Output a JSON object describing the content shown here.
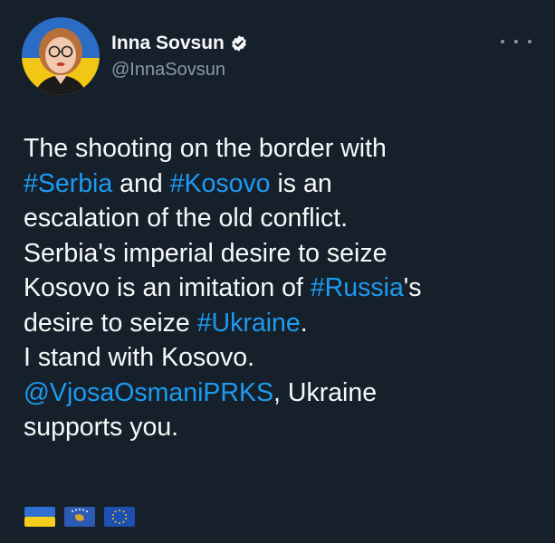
{
  "author": {
    "name": "Inna Sovsun",
    "handle": "@InnaSovsun",
    "verified": true
  },
  "tweet": {
    "line1": "The shooting on the border with",
    "l2_tag1": "#Serbia",
    "l2_mid": " and ",
    "l2_tag2": "#Kosovo",
    "l2_end": " is an",
    "line3": "escalation of the old conflict.",
    "line4": "Serbia's imperial desire to seize",
    "l5_start": "Kosovo is an imitation of ",
    "l5_tag": "#Russia",
    "l5_end": "'s",
    "l6_start": "desire to seize ",
    "l6_tag": "#Ukraine",
    "l6_end": ".",
    "line7": "I stand with Kosovo.",
    "l8_mention": "@VjosaOsmaniPRKS",
    "l8_end": ", Ukraine",
    "line9": "supports you.",
    "flags": [
      "ukraine-flag",
      "kosovo-flag",
      "eu-flag"
    ]
  },
  "colors": {
    "background": "#15202b",
    "link": "#1d9bf0",
    "secondary_text": "#8b98a5",
    "verified_badge": "#1d9bf0"
  }
}
